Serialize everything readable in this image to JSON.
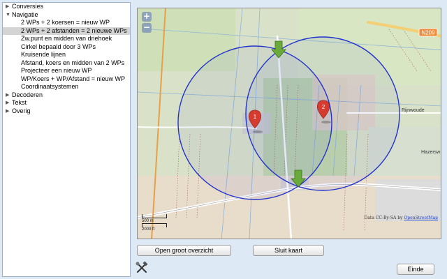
{
  "tree": {
    "items": [
      {
        "kind": "cat",
        "arrow": "▶",
        "label": "Conversies",
        "selected": false
      },
      {
        "kind": "cat",
        "arrow": "▼",
        "label": "Navigatie",
        "selected": false
      },
      {
        "kind": "sub",
        "label": "2 WPs + 2 koersen = nieuw WP",
        "selected": false
      },
      {
        "kind": "sub",
        "label": "2 WPs + 2 afstanden = 2 nieuwe WPs",
        "selected": true
      },
      {
        "kind": "sub",
        "label": "Zw.punt en midden van driehoek",
        "selected": false
      },
      {
        "kind": "sub",
        "label": "Cirkel bepaald door 3 WPs",
        "selected": false
      },
      {
        "kind": "sub",
        "label": "Kruisende lijnen",
        "selected": false
      },
      {
        "kind": "sub",
        "label": "Afstand, koers en midden van 2 WPs",
        "selected": false
      },
      {
        "kind": "sub",
        "label": "Projecteer een nieuw WP",
        "selected": false
      },
      {
        "kind": "sub",
        "label": "WP/Koers + WP/Afstand = nieuw WP",
        "selected": false
      },
      {
        "kind": "sub",
        "label": "Coordinaatsystemen",
        "selected": false
      },
      {
        "kind": "cat",
        "arrow": "▶",
        "label": "Decoderen",
        "selected": false
      },
      {
        "kind": "cat",
        "arrow": "▶",
        "label": "Tekst",
        "selected": false
      },
      {
        "kind": "cat",
        "arrow": "▶",
        "label": "Overig",
        "selected": false
      }
    ]
  },
  "map": {
    "zoom_in": "+",
    "zoom_out": "−",
    "road_badge": "N209",
    "place_rijnwoude": "Rijnwoude",
    "place_hazersw": "Hazersw",
    "marker_1": "1",
    "marker_2": "2",
    "attribution_text": "Data CC-By-SA by",
    "attribution_link": "OpenStreetMap",
    "scale_m": "500 m",
    "scale_ft": "2000 ft",
    "circle_color": "#2233cc",
    "marker_color": "#d63b2f",
    "waypoint_color": "#6aaa3a"
  },
  "buttons": {
    "overview": "Open groot overzicht",
    "close_map": "Sluit kaart",
    "end": "Einde"
  },
  "icons": {
    "tools": "tools-icon"
  }
}
